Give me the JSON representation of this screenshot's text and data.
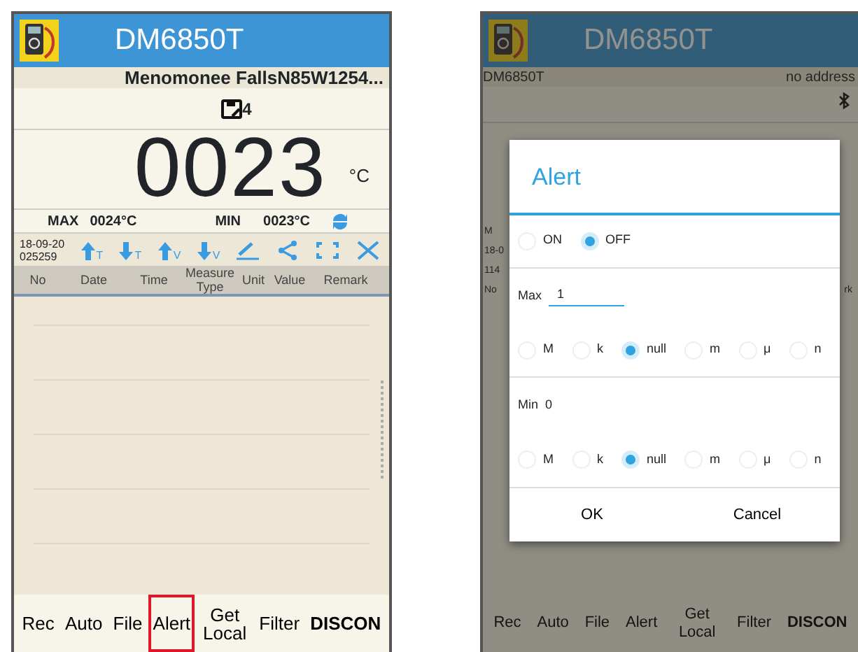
{
  "left_screen": {
    "app_title": "DM6850T",
    "location": "Menomonee FallsN85W1254...",
    "saved_count": "4",
    "reading": "0023",
    "unit": "°C",
    "max_label": "MAX",
    "max_value": "0024°C",
    "min_label": "MIN",
    "min_value": "0023°C",
    "date": "18-09-20",
    "time": "025259",
    "toolbar": [
      {
        "kind": "up",
        "letter": "T"
      },
      {
        "kind": "down",
        "letter": "T"
      },
      {
        "kind": "up",
        "letter": "V"
      },
      {
        "kind": "down",
        "letter": "V"
      },
      {
        "kind": "pencil"
      },
      {
        "kind": "share"
      },
      {
        "kind": "expand"
      },
      {
        "kind": "close"
      }
    ],
    "columns": [
      "No",
      "Date",
      "Time",
      "Measure Type",
      "Unit",
      "Value",
      "Remark"
    ],
    "bottom_bar": [
      {
        "label": "Rec",
        "highlighted": false
      },
      {
        "label": "Auto",
        "highlighted": false
      },
      {
        "label": "File",
        "highlighted": false
      },
      {
        "label": "Alert",
        "highlighted": true
      },
      {
        "label": "Get Local",
        "highlighted": false
      },
      {
        "label": "Filter",
        "highlighted": false
      },
      {
        "label": "DISCON",
        "highlighted": false,
        "bold": true
      }
    ]
  },
  "right_screen": {
    "app_title": "DM6850T",
    "device_name": "DM6850T",
    "address": "no address",
    "left_fragments": [
      "M",
      "18-0",
      "114",
      "No"
    ],
    "right_fragment": "rk",
    "dialog": {
      "title": "Alert",
      "power": [
        {
          "label": "ON",
          "selected": false
        },
        {
          "label": "OFF",
          "selected": true
        }
      ],
      "max": {
        "label": "Max",
        "value": "1",
        "units": [
          {
            "label": "M",
            "selected": false
          },
          {
            "label": "k",
            "selected": false
          },
          {
            "label": "null",
            "selected": true
          },
          {
            "label": "m",
            "selected": false
          },
          {
            "label": "μ",
            "selected": false
          },
          {
            "label": "n",
            "selected": false
          }
        ]
      },
      "min": {
        "label": "Min",
        "value": "0",
        "units": [
          {
            "label": "M",
            "selected": false
          },
          {
            "label": "k",
            "selected": false
          },
          {
            "label": "null",
            "selected": true
          },
          {
            "label": "m",
            "selected": false
          },
          {
            "label": "μ",
            "selected": false
          },
          {
            "label": "n",
            "selected": false
          }
        ]
      },
      "buttons": [
        "OK",
        "Cancel"
      ]
    },
    "bottom_bar": [
      {
        "label": "Rec",
        "bold": false
      },
      {
        "label": "Auto",
        "bold": false
      },
      {
        "label": "File",
        "bold": false
      },
      {
        "label": "Alert",
        "bold": false
      },
      {
        "label": "Get Local",
        "bold": false
      },
      {
        "label": "Filter",
        "bold": false
      },
      {
        "label": "DISCON",
        "bold": true
      }
    ]
  }
}
